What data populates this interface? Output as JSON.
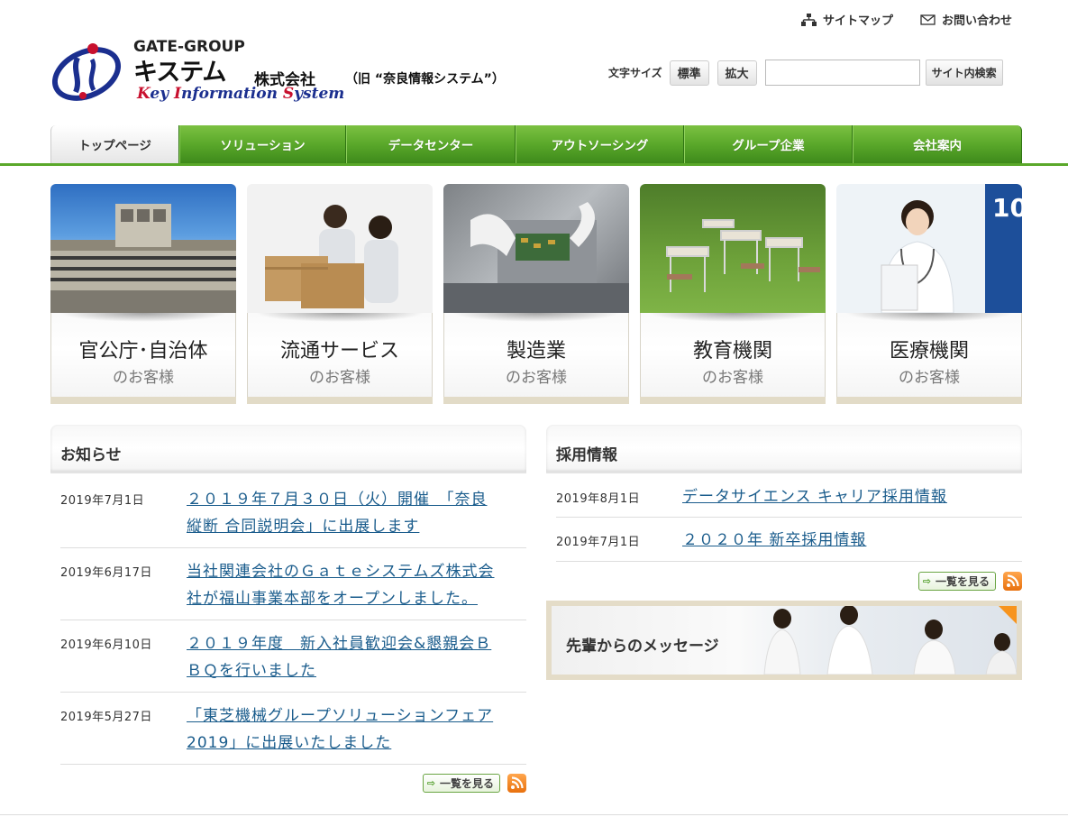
{
  "header": {
    "logo": {
      "group": "GATE-GROUP",
      "name": "キステム",
      "kaisha": "株式会社",
      "former": "（旧 “奈良情報システム”）",
      "english_1": "K",
      "english_2": "ey ",
      "english_3": "I",
      "english_4": "nformation ",
      "english_5": "S",
      "english_6": "ystem"
    },
    "util_links": [
      {
        "label": "サイトマップ",
        "icon": "sitemap-icon"
      },
      {
        "label": "お問い合わせ",
        "icon": "envelope-icon"
      }
    ],
    "font_size_label": "文字サイズ",
    "font_size_normal": "標準",
    "font_size_large": "拡大",
    "search": {
      "value": "",
      "placeholder": "",
      "button": "サイト内検索"
    }
  },
  "nav": [
    "トップページ",
    "ソリューション",
    "データセンター",
    "アウトソーシング",
    "グループ企業",
    "会社案内"
  ],
  "nav_active": "トップページ",
  "tiles": [
    {
      "title": "官公庁･自治体",
      "sub": "のお客様"
    },
    {
      "title": "流通サービス",
      "sub": "のお客様"
    },
    {
      "title": "製造業",
      "sub": "のお客様"
    },
    {
      "title": "教育機関",
      "sub": "のお客様"
    },
    {
      "title": "医療機関",
      "sub": "のお客様"
    }
  ],
  "news": {
    "title": "お知らせ",
    "items": [
      {
        "date": "2019年7月1日",
        "line1": "２０１９年７月３０日（火）開催　「奈良",
        "line2": "縦断 合同説明会」に出展します"
      },
      {
        "date": "2019年6月17日",
        "line1": "当社関連会社のＧａｔｅシステムズ株式会",
        "line2": "社が福山事業本部をオープンしました。"
      },
      {
        "date": "2019年6月10日",
        "line1": "２０１９年度　新入社員歓迎会&懇親会Ｂ",
        "line2": "ＢＱを行いました"
      },
      {
        "date": "2019年5月27日",
        "line1": "「東芝機械グループソリューションフェア",
        "line2": "2019」に出展いたしました"
      }
    ],
    "more": "一覧を見る"
  },
  "recruit": {
    "title": "採用情報",
    "items": [
      {
        "date": "2019年8月1日",
        "text": "データサイエンス キャリア採用情報"
      },
      {
        "date": "2019年7月1日",
        "text": "２０２０年 新卒採用情報"
      }
    ],
    "more": "一覧を見る"
  },
  "message_banner": "先輩からのメッセージ",
  "colors": {
    "nav_green": "#5aa82a",
    "link_blue": "#1a5c8c",
    "rss_orange": "#f7941d",
    "banner_border": "#e4dcc8"
  }
}
